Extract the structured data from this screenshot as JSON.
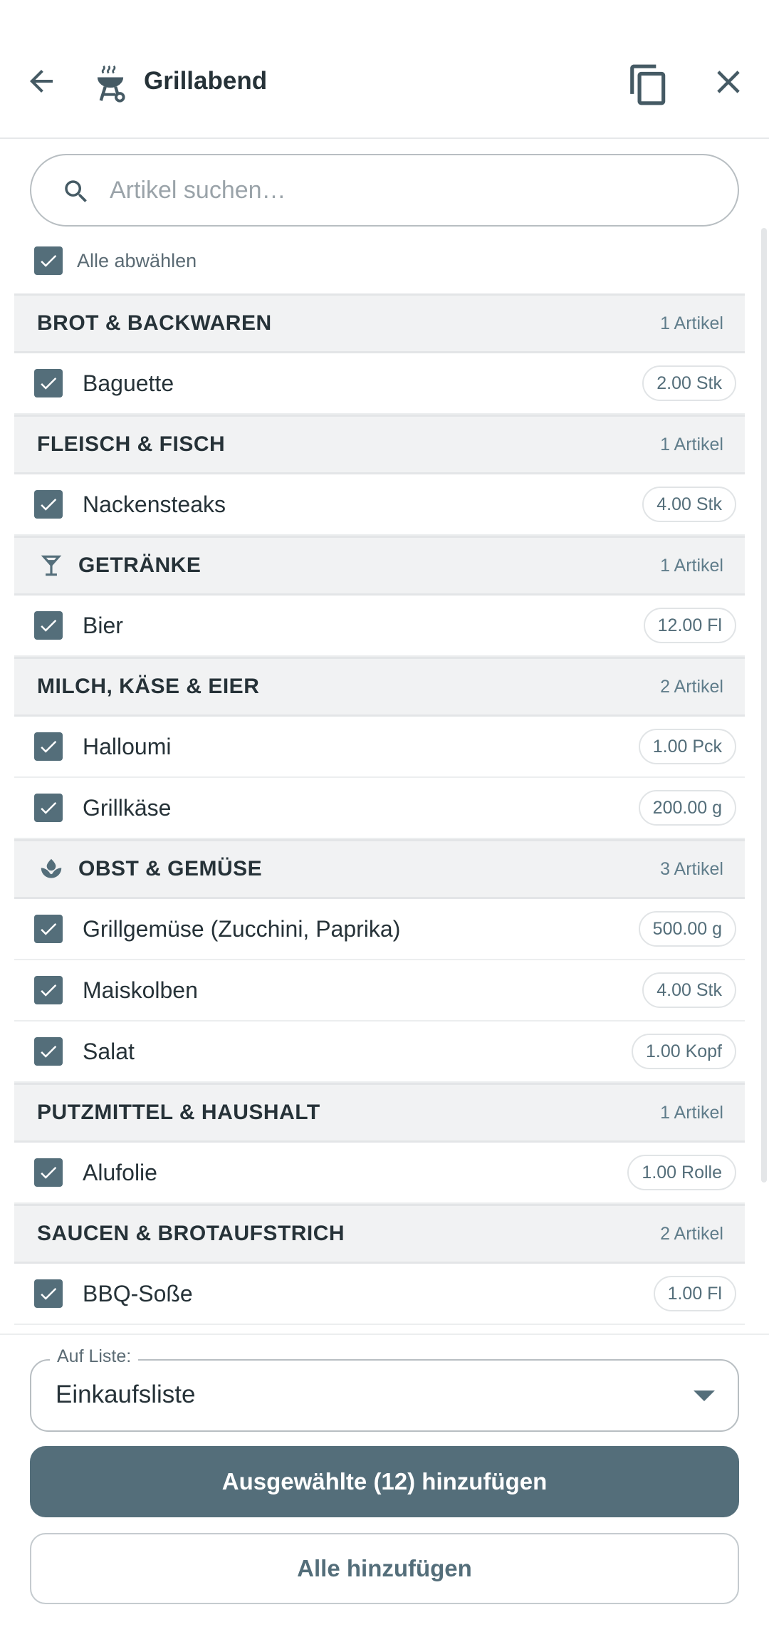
{
  "header": {
    "title": "Grillabend",
    "icons": {
      "back": "arrow-back-icon",
      "list": "grill-icon",
      "copy": "copy-icon",
      "close": "close-icon"
    }
  },
  "search": {
    "placeholder": "Artikel suchen…",
    "value": ""
  },
  "deselect_all": {
    "label": "Alle abwählen",
    "checked": true
  },
  "categories": [
    {
      "name": "BROT & BACKWAREN",
      "count": "1 Artikel",
      "icon": "",
      "items": [
        {
          "name": "Baguette",
          "qty": "2.00 Stk",
          "checked": true
        }
      ]
    },
    {
      "name": "FLEISCH & FISCH",
      "count": "1 Artikel",
      "icon": "",
      "items": [
        {
          "name": "Nackensteaks",
          "qty": "4.00 Stk",
          "checked": true
        }
      ]
    },
    {
      "name": "GETRÄNKE",
      "count": "1 Artikel",
      "icon": "cocktail-glass-icon",
      "items": [
        {
          "name": "Bier",
          "qty": "12.00 Fl",
          "checked": true
        }
      ]
    },
    {
      "name": "MILCH, KÄSE & EIER",
      "count": "2 Artikel",
      "icon": "",
      "items": [
        {
          "name": "Halloumi",
          "qty": "1.00 Pck",
          "checked": true
        },
        {
          "name": "Grillkäse",
          "qty": "200.00 g",
          "checked": true
        }
      ]
    },
    {
      "name": "OBST & GEMÜSE",
      "count": "3 Artikel",
      "icon": "sprout-icon",
      "items": [
        {
          "name": "Grillgemüse (Zucchini, Paprika)",
          "qty": "500.00 g",
          "checked": true
        },
        {
          "name": "Maiskolben",
          "qty": "4.00 Stk",
          "checked": true
        },
        {
          "name": "Salat",
          "qty": "1.00 Kopf",
          "checked": true
        }
      ]
    },
    {
      "name": "PUTZMITTEL & HAUSHALT",
      "count": "1 Artikel",
      "icon": "",
      "items": [
        {
          "name": "Alufolie",
          "qty": "1.00 Rolle",
          "checked": true
        }
      ]
    },
    {
      "name": "SAUCEN & BROTAUFSTRICH",
      "count": "2 Artikel",
      "icon": "",
      "items": [
        {
          "name": "BBQ-Soße",
          "qty": "1.00 Fl",
          "checked": true
        }
      ]
    }
  ],
  "target_list": {
    "label": "Auf Liste:",
    "value": "Einkaufsliste"
  },
  "actions": {
    "add_selected": "Ausgewählte (12) hinzufügen",
    "add_all": "Alle hinzufügen"
  },
  "colors": {
    "accent": "#546e7a",
    "text": "#263238",
    "category_bg": "#f1f2f3"
  }
}
